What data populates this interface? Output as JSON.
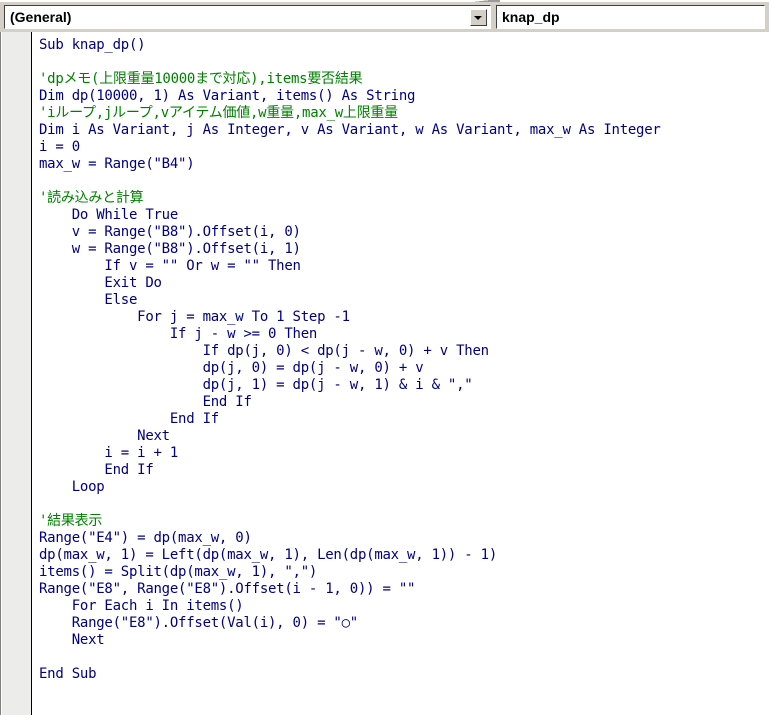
{
  "window": {
    "title": "knap_dp",
    "app": "Microsoft Visual Basic for Applications - Code Window"
  },
  "toolbar": {
    "object_combo": {
      "label": "(General)",
      "value": "(General)",
      "dropdown_icon": "chevron-down-icon"
    },
    "procedure_combo": {
      "label": "knap_dp",
      "value": "knap_dp",
      "dropdown_icon": "chevron-down-icon"
    }
  },
  "colors": {
    "comment": "#008000",
    "code": "#000080",
    "background": "#ffffff",
    "margin_bar": "#ececeb",
    "chrome": "#d4d0c8"
  },
  "code": {
    "language": "VBA",
    "lines": [
      {
        "text": "Sub knap_dp()",
        "kind": "code"
      },
      {
        "text": "",
        "kind": "blank"
      },
      {
        "text": "'dpメモ(上限重量10000まで対応),items要否結果",
        "kind": "comment"
      },
      {
        "text": "Dim dp(10000, 1) As Variant, items() As String",
        "kind": "code"
      },
      {
        "text": "'iループ,jループ,vアイテム価値,w重量,max_w上限重量",
        "kind": "comment"
      },
      {
        "text": "Dim i As Variant, j As Integer, v As Variant, w As Variant, max_w As Integer",
        "kind": "code"
      },
      {
        "text": "i = 0",
        "kind": "code"
      },
      {
        "text": "max_w = Range(\"B4\")",
        "kind": "code"
      },
      {
        "text": "",
        "kind": "blank"
      },
      {
        "text": "'読み込みと計算",
        "kind": "comment"
      },
      {
        "text": "    Do While True",
        "kind": "code"
      },
      {
        "text": "    v = Range(\"B8\").Offset(i, 0)",
        "kind": "code"
      },
      {
        "text": "    w = Range(\"B8\").Offset(i, 1)",
        "kind": "code"
      },
      {
        "text": "        If v = \"\" Or w = \"\" Then",
        "kind": "code"
      },
      {
        "text": "        Exit Do",
        "kind": "code"
      },
      {
        "text": "        Else",
        "kind": "code"
      },
      {
        "text": "            For j = max_w To 1 Step -1",
        "kind": "code"
      },
      {
        "text": "                If j - w >= 0 Then",
        "kind": "code"
      },
      {
        "text": "                    If dp(j, 0) < dp(j - w, 0) + v Then",
        "kind": "code"
      },
      {
        "text": "                    dp(j, 0) = dp(j - w, 0) + v",
        "kind": "code"
      },
      {
        "text": "                    dp(j, 1) = dp(j - w, 1) & i & \",\"",
        "kind": "code"
      },
      {
        "text": "                    End If",
        "kind": "code"
      },
      {
        "text": "                End If",
        "kind": "code"
      },
      {
        "text": "            Next",
        "kind": "code"
      },
      {
        "text": "        i = i + 1",
        "kind": "code"
      },
      {
        "text": "        End If",
        "kind": "code"
      },
      {
        "text": "    Loop",
        "kind": "code"
      },
      {
        "text": "",
        "kind": "blank"
      },
      {
        "text": "'結果表示",
        "kind": "comment"
      },
      {
        "text": "Range(\"E4\") = dp(max_w, 0)",
        "kind": "code"
      },
      {
        "text": "dp(max_w, 1) = Left(dp(max_w, 1), Len(dp(max_w, 1)) - 1)",
        "kind": "code"
      },
      {
        "text": "items() = Split(dp(max_w, 1), \",\")",
        "kind": "code"
      },
      {
        "text": "Range(\"E8\", Range(\"E8\").Offset(i - 1, 0)) = \"\"",
        "kind": "code"
      },
      {
        "text": "    For Each i In items()",
        "kind": "code"
      },
      {
        "text": "    Range(\"E8\").Offset(Val(i), 0) = \"○\"",
        "kind": "code"
      },
      {
        "text": "    Next",
        "kind": "code"
      },
      {
        "text": "",
        "kind": "blank"
      },
      {
        "text": "End Sub",
        "kind": "code"
      }
    ]
  }
}
